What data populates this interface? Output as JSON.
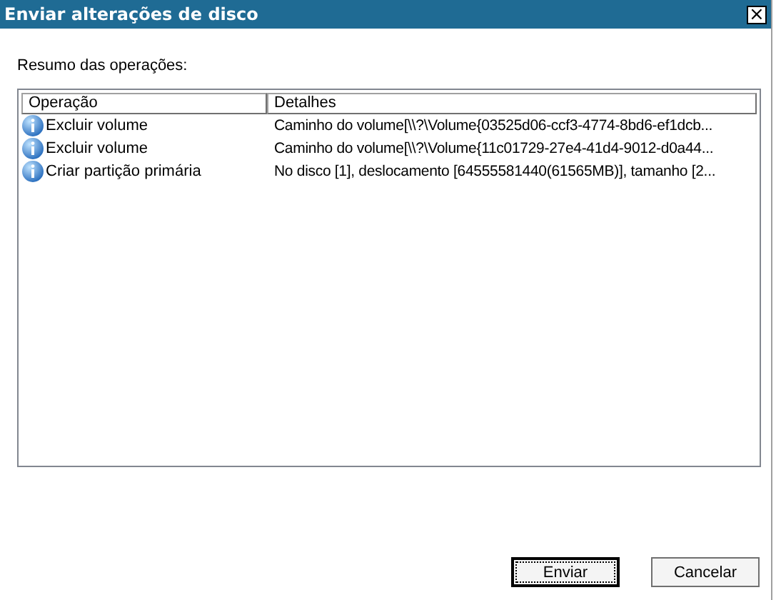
{
  "window": {
    "title": "Enviar alterações de disco",
    "close": "×"
  },
  "summary_label": "Resumo das operações:",
  "table": {
    "columns": [
      "Operação",
      "Detalhes"
    ],
    "rows": [
      {
        "operation": "Excluir volume",
        "details": "Caminho do volume[\\\\?\\Volume{03525d06-ccf3-4774-8bd6-ef1dcb..."
      },
      {
        "operation": "Excluir volume",
        "details": "Caminho do volume[\\\\?\\Volume{11c01729-27e4-41d4-9012-d0a44..."
      },
      {
        "operation": "Criar partição primária",
        "details": "No disco [1], deslocamento [64555581440(61565MB)], tamanho [2..."
      }
    ]
  },
  "buttons": [
    {
      "label": "Enviar",
      "default": true
    },
    {
      "label": "Cancelar",
      "default": false
    }
  ]
}
